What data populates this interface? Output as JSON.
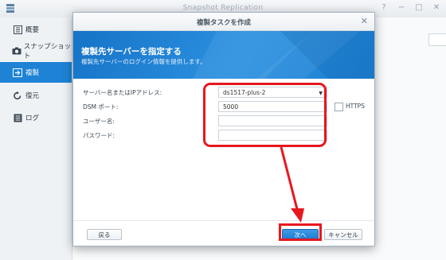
{
  "app": {
    "title": "Snapshot Replication",
    "window_controls": [
      "?",
      "−",
      "□",
      "✕"
    ]
  },
  "sidebar": {
    "items": [
      {
        "label": "概要",
        "icon": "overview-icon"
      },
      {
        "label": "スナップショット",
        "icon": "camera-icon"
      },
      {
        "label": "複製",
        "icon": "replication-icon",
        "active": true
      },
      {
        "label": "復元",
        "icon": "recovery-icon"
      },
      {
        "label": "ログ",
        "icon": "log-icon"
      }
    ]
  },
  "modal": {
    "title": "複製タスクを作成",
    "banner_title": "複製先サーバーを指定する",
    "banner_subtitle": "複製先サーバーのログイン情報を提供します。",
    "fields": {
      "server_label": "サーバー名またはIPアドレス:",
      "server_value": "ds1517-plus-2",
      "port_label": "DSM ポート:",
      "port_value": "5000",
      "https_label": "HTTPS",
      "user_label": "ユーザー名:",
      "user_value": "",
      "password_label": "パスワード:",
      "password_value": ""
    },
    "buttons": {
      "back": "戻る",
      "next": "次へ",
      "cancel": "キャンセル"
    }
  },
  "colors": {
    "accent": "#1e83d5",
    "annotation": "#e8171f"
  }
}
